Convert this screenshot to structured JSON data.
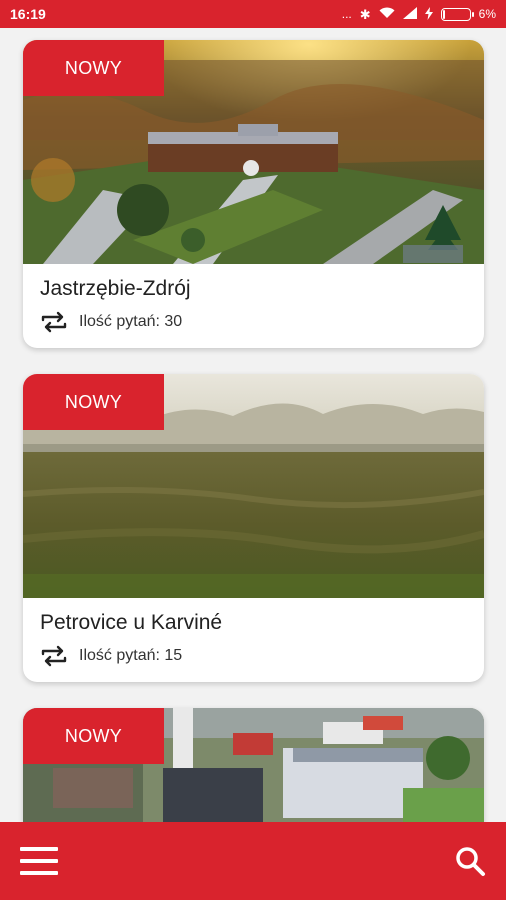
{
  "status_bar": {
    "time": "16:19",
    "dots": "...",
    "battery_percent": "6%",
    "battery_level": 0.06,
    "icons": [
      "bluetooth-icon",
      "wifi-icon",
      "signal-icon",
      "charging-icon",
      "battery-icon"
    ]
  },
  "cards": [
    {
      "badge": "NOWY",
      "title": "Jastrzębie-Zdrój",
      "questions_label": "Ilość pytań: 30",
      "icon": "swap-icon"
    },
    {
      "badge": "NOWY",
      "title": "Petrovice u Karviné",
      "questions_label": "Ilość pytań: 15",
      "icon": "swap-icon"
    },
    {
      "badge": "NOWY",
      "title": "",
      "questions_label": "",
      "icon": "swap-icon"
    }
  ],
  "bottom_bar": {
    "menu_icon": "menu-icon",
    "search_icon": "search-icon"
  },
  "colors": {
    "accent": "#d9232d",
    "background": "#f2f2f2",
    "card": "#ffffff"
  }
}
